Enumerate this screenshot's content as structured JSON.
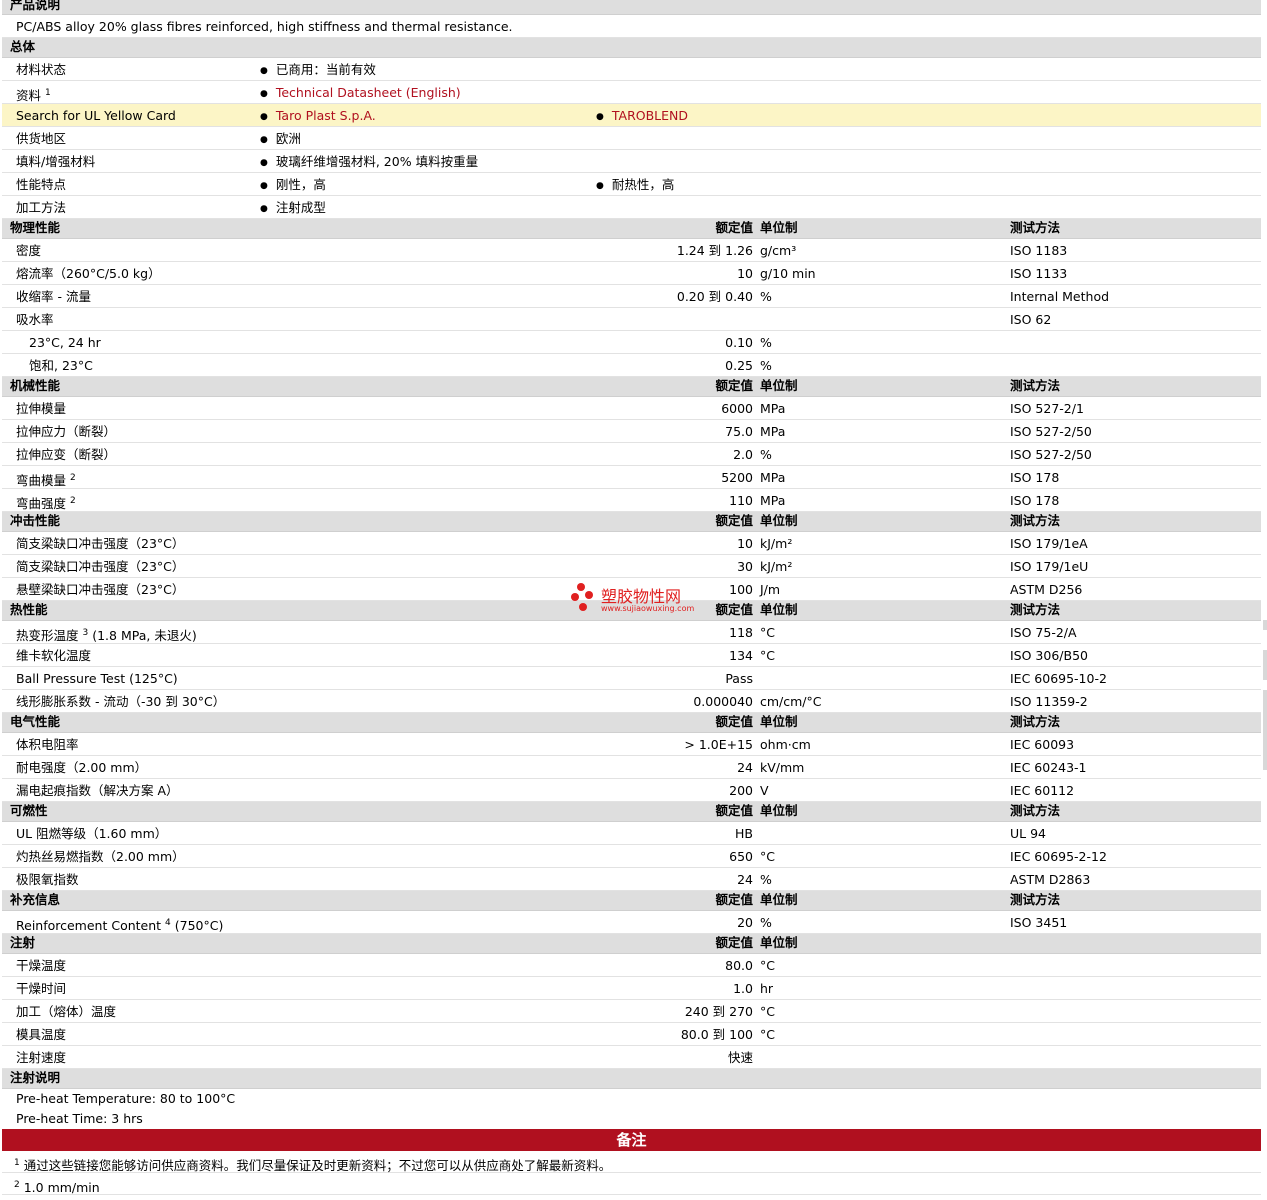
{
  "product_desc": {
    "heading": "产品说明",
    "text": "PC/ABS alloy 20% glass fibres reinforced, high stiffness and thermal resistance."
  },
  "general": {
    "heading": "总体",
    "material_status": {
      "label": "材料状态",
      "value": "已商用：当前有效"
    },
    "data": {
      "label": "资料",
      "sup": "1",
      "link": "Technical Datasheet (English)"
    },
    "ul_search": {
      "label": "Search for UL Yellow Card",
      "link1": "Taro Plast S.p.A.",
      "link2": "TAROBLEND"
    },
    "supply_region": {
      "label": "供货地区",
      "value": "欧洲"
    },
    "filler": {
      "label": "填料/增强材料",
      "value": "玻璃纤维增强材料, 20% 填料按重量"
    },
    "features": {
      "label": "性能特点",
      "value1": "刚性，高",
      "value2": "耐热性，高"
    },
    "processing": {
      "label": "加工方法",
      "value": "注射成型"
    }
  },
  "col_headers": {
    "nominal": "额定值",
    "unit": "单位制",
    "method": "测试方法"
  },
  "physical": {
    "heading": "物理性能",
    "rows": [
      {
        "label": "密度",
        "value": "1.24 到  1.26",
        "unit": "g/cm³",
        "method": "ISO 1183"
      },
      {
        "label": "熔流率（260°C/5.0 kg）",
        "value": "10",
        "unit": "g/10 min",
        "method": "ISO 1133"
      },
      {
        "label": "收缩率  - 流量",
        "value": "0.20 到  0.40",
        "unit": "%",
        "method": "Internal Method"
      },
      {
        "label": "吸水率",
        "value": "",
        "unit": "",
        "method": "ISO 62"
      },
      {
        "label": "23°C, 24 hr",
        "value": "0.10",
        "unit": "%",
        "method": ""
      },
      {
        "label": "饱和, 23°C",
        "value": "0.25",
        "unit": "%",
        "method": ""
      }
    ]
  },
  "mechanical": {
    "heading": "机械性能",
    "rows": [
      {
        "label": "拉伸模量",
        "sup": "",
        "value": "6000",
        "unit": "MPa",
        "method": "ISO 527-2/1"
      },
      {
        "label": "拉伸应力（断裂）",
        "sup": "",
        "value": "75.0",
        "unit": "MPa",
        "method": "ISO 527-2/50"
      },
      {
        "label": "拉伸应变（断裂）",
        "sup": "",
        "value": "2.0",
        "unit": "%",
        "method": "ISO 527-2/50"
      },
      {
        "label": "弯曲模量",
        "sup": "2",
        "value": "5200",
        "unit": "MPa",
        "method": "ISO 178"
      },
      {
        "label": "弯曲强度",
        "sup": "2",
        "value": "110",
        "unit": "MPa",
        "method": "ISO 178"
      }
    ]
  },
  "impact": {
    "heading": "冲击性能",
    "rows": [
      {
        "label": "简支梁缺口冲击强度（23°C）",
        "value": "10",
        "unit": "kJ/m²",
        "method": "ISO 179/1eA"
      },
      {
        "label": "简支梁缺口冲击强度（23°C）",
        "value": "30",
        "unit": "kJ/m²",
        "method": "ISO 179/1eU"
      },
      {
        "label": "悬壁梁缺口冲击强度（23°C）",
        "value": "100",
        "unit": "J/m",
        "method": "ASTM D256"
      }
    ]
  },
  "thermal": {
    "heading": "热性能",
    "rows": [
      {
        "label": "热变形温度",
        "sup": "3",
        "label_after": "(1.8 MPa, 未退火)",
        "value": "118",
        "unit": "°C",
        "method": "ISO 75-2/A"
      },
      {
        "label": "维卡软化温度",
        "sup": "",
        "label_after": "",
        "value": "134",
        "unit": "°C",
        "method": "ISO 306/B50"
      },
      {
        "label": "Ball Pressure Test (125°C)",
        "sup": "",
        "label_after": "",
        "value": "Pass",
        "unit": "",
        "method": "IEC 60695-10-2"
      },
      {
        "label": "线形膨胀系数  - 流动（-30 到  30°C）",
        "sup": "",
        "label_after": "",
        "value": "0.000040",
        "unit": "cm/cm/°C",
        "method": "ISO 11359-2"
      }
    ]
  },
  "electrical": {
    "heading": "电气性能",
    "rows": [
      {
        "label": "体积电阻率",
        "value": "> 1.0E+15",
        "unit": "ohm·cm",
        "method": "IEC 60093"
      },
      {
        "label": "耐电强度（2.00 mm）",
        "value": "24",
        "unit": "kV/mm",
        "method": "IEC 60243-1"
      },
      {
        "label": "漏电起痕指数（解决方案  A）",
        "value": "200",
        "unit": "V",
        "method": "IEC 60112"
      }
    ]
  },
  "flammability": {
    "heading": "可燃性",
    "rows": [
      {
        "label": "UL 阻燃等级（1.60 mm）",
        "value": "HB",
        "unit": "",
        "method": "UL 94"
      },
      {
        "label": "灼热丝易燃指数（2.00 mm）",
        "value": "650",
        "unit": "°C",
        "method": "IEC 60695-2-12"
      },
      {
        "label": "极限氧指数",
        "value": "24",
        "unit": "%",
        "method": "ASTM D2863"
      }
    ]
  },
  "supplementary": {
    "heading": "补充信息",
    "rows": [
      {
        "label": "Reinforcement Content",
        "sup": "4",
        "label_after": "(750°C)",
        "value": "20",
        "unit": "%",
        "method": "ISO 3451"
      }
    ]
  },
  "injection": {
    "heading": "注射",
    "rows": [
      {
        "label": "干燥温度",
        "value": "80.0",
        "unit": "°C"
      },
      {
        "label": "干燥时间",
        "value": "1.0",
        "unit": "hr"
      },
      {
        "label": "加工（熔体）温度",
        "value": "240 到  270",
        "unit": "°C"
      },
      {
        "label": "模具温度",
        "value": "80.0 到  100",
        "unit": "°C"
      },
      {
        "label": "注射速度",
        "value": "快速",
        "unit": ""
      }
    ]
  },
  "injection_notes": {
    "heading": "注射说明",
    "lines": [
      "Pre-heat Temperature: 80 to 100°C",
      "Pre-heat Time: 3 hrs"
    ]
  },
  "remarks": {
    "heading": "备注",
    "notes": [
      {
        "num": "1",
        "text": "通过这些链接您能够访问供应商资料。我们尽量保证及时更新资料；不过您可以从供应商处了解最新资料。"
      },
      {
        "num": "2",
        "text": "1.0 mm/min"
      }
    ]
  },
  "watermark": {
    "title": "塑胶物性网",
    "url": "www.sujiaowuxing.com"
  },
  "colors": {
    "link": "#b0101f",
    "section_bg": "#dedede",
    "highlight_bg": "#fcf5c6",
    "banner_bg": "#b0101f"
  }
}
